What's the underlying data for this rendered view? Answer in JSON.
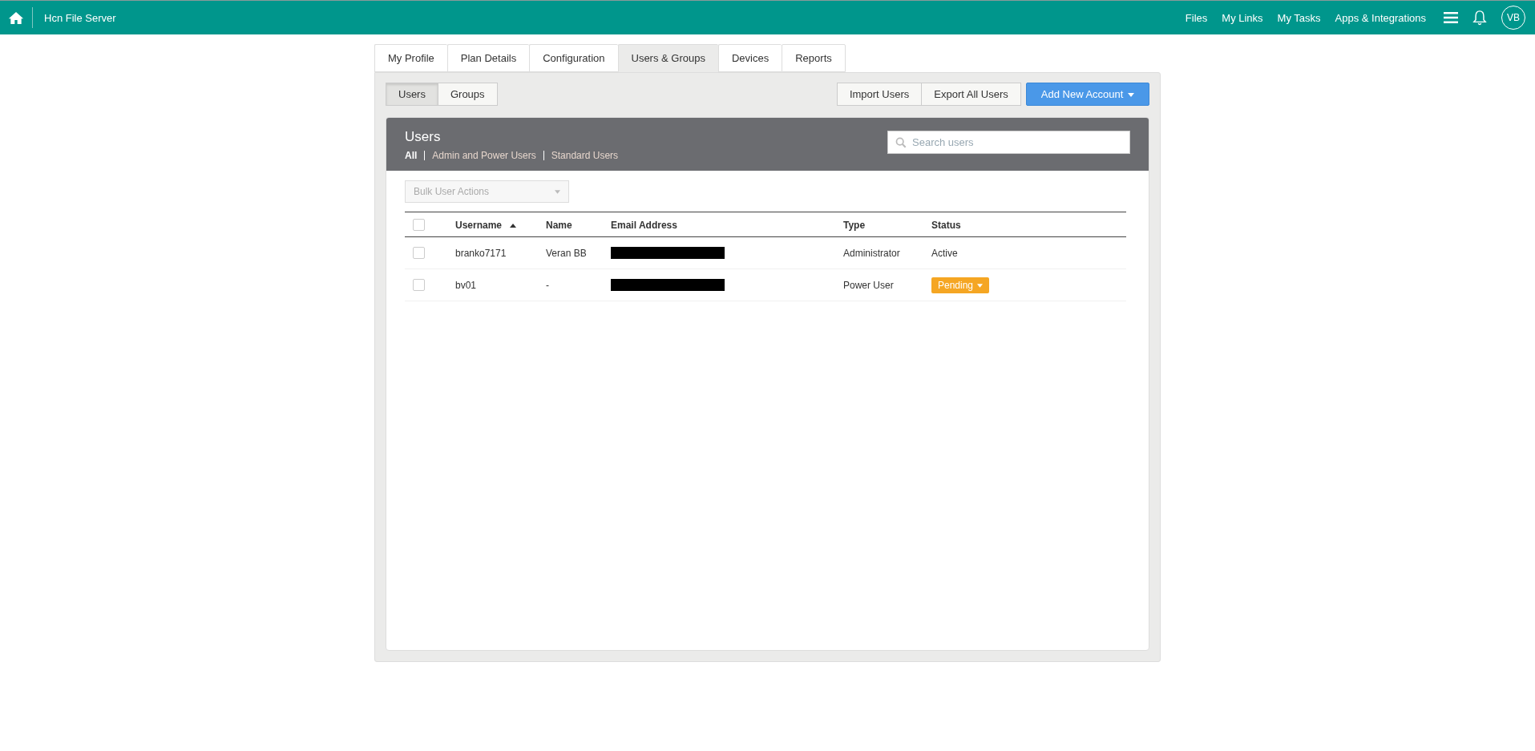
{
  "top_bar": {
    "title": "Hcn File Server",
    "links": [
      "Files",
      "My Links",
      "My Tasks",
      "Apps & Integrations"
    ],
    "avatar": "VB"
  },
  "tabs": [
    {
      "label": "My Profile",
      "selected": false
    },
    {
      "label": "Plan Details",
      "selected": false
    },
    {
      "label": "Configuration",
      "selected": false
    },
    {
      "label": "Users & Groups",
      "selected": true
    },
    {
      "label": "Devices",
      "selected": false
    },
    {
      "label": "Reports",
      "selected": false
    }
  ],
  "view_toggle": [
    {
      "label": "Users",
      "selected": true
    },
    {
      "label": "Groups",
      "selected": false
    }
  ],
  "actions": {
    "buttons": [
      "Import Users",
      "Export All Users"
    ],
    "primary": "Add New Account"
  },
  "users_panel": {
    "title": "Users",
    "filters": [
      {
        "label": "All",
        "selected": true
      },
      {
        "label": "Admin and Power Users",
        "selected": false
      },
      {
        "label": "Standard Users",
        "selected": false
      }
    ],
    "search": {
      "placeholder": "Search users"
    }
  },
  "bulk_actions": {
    "placeholder": "Bulk User Actions",
    "disabled": true
  },
  "table": {
    "select_all_checked": false,
    "columns": [
      {
        "label": "Username",
        "sorted": true
      },
      {
        "label": "Name",
        "sorted": false
      },
      {
        "label": "Email Address",
        "sorted": false
      },
      {
        "label": "Type",
        "sorted": false
      },
      {
        "label": "Status",
        "sorted": false
      }
    ],
    "rows": [
      {
        "checked": false,
        "username": "branko7171",
        "name": "Veran BB",
        "email_redacted": true,
        "type": "Administrator",
        "status": {
          "label": "Active",
          "kind": "text"
        }
      },
      {
        "checked": false,
        "username": "bv01",
        "name": "-",
        "email_redacted": true,
        "type": "Power User",
        "status": {
          "label": "Pending",
          "kind": "dropdown"
        }
      }
    ]
  }
}
